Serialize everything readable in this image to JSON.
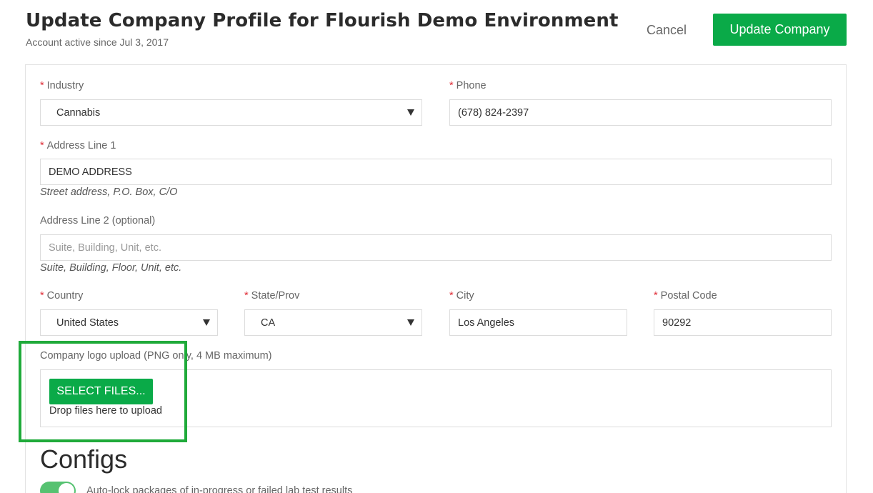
{
  "header": {
    "title": "Update Company Profile for Flourish Demo Environment",
    "subtitle": "Account active since Jul 3, 2017",
    "cancel_label": "Cancel",
    "update_label": "Update Company"
  },
  "form": {
    "industry": {
      "label": "Industry",
      "value": "Cannabis"
    },
    "phone": {
      "label": "Phone",
      "value": "(678) 824-2397"
    },
    "address1": {
      "label": "Address Line 1",
      "value": "DEMO ADDRESS",
      "hint": "Street address, P.O. Box, C/O"
    },
    "address2": {
      "label": "Address Line 2 (optional)",
      "placeholder": "Suite, Building, Unit, etc.",
      "hint": "Suite, Building, Floor, Unit, etc."
    },
    "country": {
      "label": "Country",
      "value": "United States"
    },
    "state": {
      "label": "State/Prov",
      "value": "CA"
    },
    "city": {
      "label": "City",
      "value": "Los Angeles"
    },
    "postal": {
      "label": "Postal Code",
      "value": "90292"
    },
    "required_mark": "*"
  },
  "upload": {
    "label": "Company logo upload (PNG only, 4 MB maximum)",
    "button_label": "SELECT FILES...",
    "drop_text": "Drop files here to upload"
  },
  "configs": {
    "title": "Configs",
    "auto_lock_label": "Auto-lock packages of in-progress or failed lab test results",
    "auto_lock_enabled": true
  },
  "colors": {
    "accent": "#0aaa48",
    "required": "#e0303a",
    "highlight": "#1faa3a"
  }
}
